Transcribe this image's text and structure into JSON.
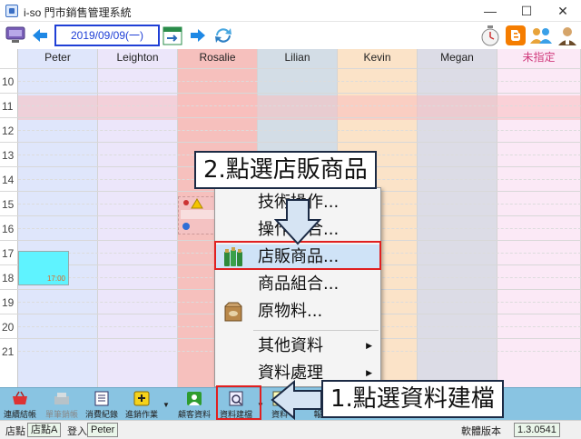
{
  "window": {
    "title": "i-so 門市銷售管理系統",
    "minimize": "—",
    "maximize": "☐",
    "close": "✕"
  },
  "toolbar": {
    "date": "2019/09/09(一)"
  },
  "schedule": {
    "staff": [
      {
        "name": "Peter",
        "color": "#dfe6fb"
      },
      {
        "name": "Leighton",
        "color": "#ece6fa"
      },
      {
        "name": "Rosalie",
        "color": "#f6c0bd"
      },
      {
        "name": "Lilian",
        "color": "#d3dde6"
      },
      {
        "name": "Kevin",
        "color": "#fbe3c8"
      },
      {
        "name": "Megan",
        "color": "#dcdce6"
      },
      {
        "name": "未指定",
        "color": "#fbe9f6"
      }
    ],
    "hours": [
      "10",
      "11",
      "12",
      "13",
      "14",
      "15",
      "16",
      "17",
      "18",
      "19",
      "20",
      "21"
    ],
    "appointment_time": "17:00"
  },
  "context_menu": {
    "items": [
      {
        "label": "技術操作...",
        "has_submenu": false
      },
      {
        "label": "操作組合...",
        "has_submenu": false
      },
      {
        "label": "店販商品...",
        "has_submenu": false,
        "selected": true
      },
      {
        "label": "商品組合...",
        "has_submenu": false
      },
      {
        "label": "原物料...",
        "has_submenu": false
      },
      {
        "label": "其他資料",
        "has_submenu": true
      },
      {
        "label": "資料處理",
        "has_submenu": true
      }
    ]
  },
  "callouts": {
    "step2": "2.點選店販商品",
    "step1": "1.點選資料建檔"
  },
  "bottom_toolbar": {
    "items": [
      {
        "label": "連續結帳",
        "icon": "basket-icon",
        "color": "#d33",
        "disabled": false
      },
      {
        "label": "單筆銷帳",
        "icon": "register-icon",
        "color": "#9aa",
        "disabled": true
      },
      {
        "label": "消費紀錄",
        "icon": "record-icon",
        "color": "#e8e8e8",
        "disabled": false
      },
      {
        "label": "進銷作業",
        "icon": "stock-icon",
        "color": "#f5d21b",
        "disabled": false
      },
      {
        "label": "顧客資料",
        "icon": "customer-icon",
        "color": "#2e9c2e",
        "disabled": false
      },
      {
        "label": "資料建檔",
        "icon": "database-icon",
        "color": "#eef",
        "disabled": false
      },
      {
        "label": "資料",
        "icon": "report-icon",
        "color": "#ffb",
        "disabled": false
      },
      {
        "label": "報",
        "icon": "chart-icon",
        "color": "#ffb",
        "disabled": false
      }
    ]
  },
  "status_bar": {
    "store_label": "店點",
    "store_value": "店點A",
    "login_label": "登入",
    "login_value": "Peter",
    "version_label": "軟體版本",
    "version_value": "1.3.0541"
  }
}
